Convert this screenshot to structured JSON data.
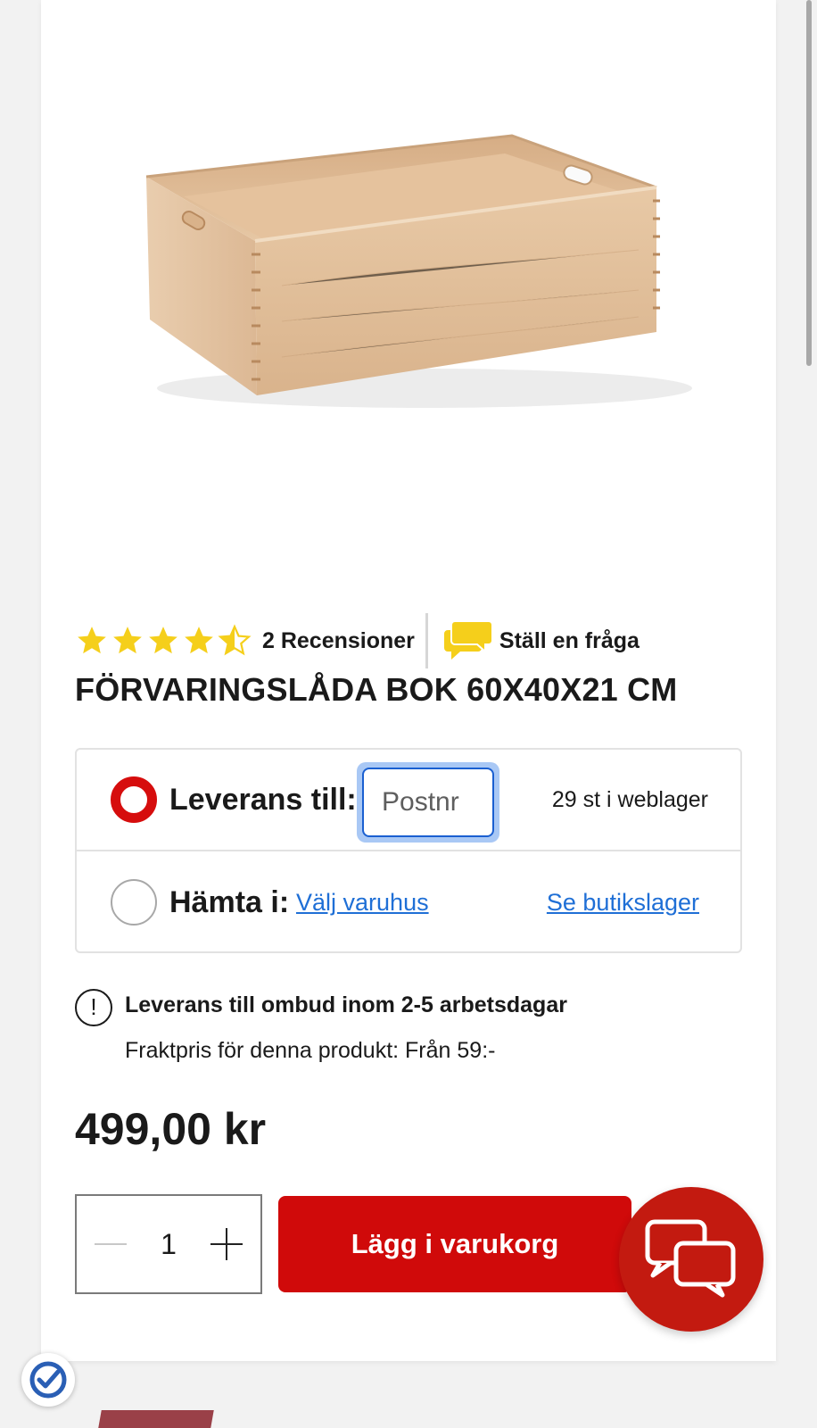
{
  "product": {
    "title": "FÖRVARINGSLÅDA BOK 60X40X21 CM",
    "image_icon": "wooden-storage-box-image",
    "rating_stars": 4.5,
    "rating_max": 5,
    "review_label": "2 Recensioner",
    "ask_question_label": "Ställ en fråga",
    "price": "499,00 kr"
  },
  "delivery": {
    "delivery_label": "Leverans till:",
    "postnr_placeholder": "Postnr",
    "postnr_value": "",
    "stock_web": "29 st i weblager",
    "pickup_label": "Hämta i:",
    "choose_store_link": "Välj varuhus",
    "store_stock_link": "Se butikslager",
    "selected_option": "delivery"
  },
  "info": {
    "title": "Leverans till ombud inom 2-5 arbetsdagar",
    "freight": "Fraktpris för denna produkt: Från 59:-"
  },
  "cart": {
    "quantity": "1",
    "add_label": "Lägg i varukorg"
  },
  "colors": {
    "accent_red": "#d00a0a",
    "star_yellow": "#f5cf1b",
    "link_blue": "#1f6fd6",
    "chat_bubble_yellow": "#f5cf1b"
  }
}
